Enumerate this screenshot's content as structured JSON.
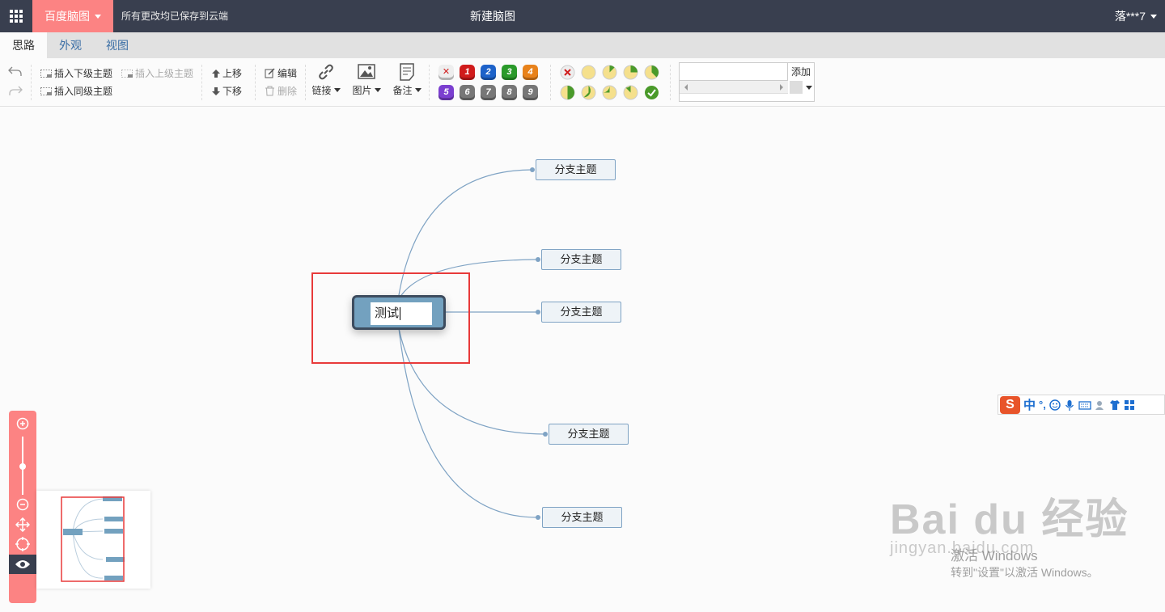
{
  "topbar": {
    "brand": "百度脑图",
    "save_status": "所有更改均已保存到云端",
    "doc_title": "新建脑图",
    "user": "落***7"
  },
  "tabs": [
    {
      "label": "思路",
      "active": true
    },
    {
      "label": "外观",
      "active": false
    },
    {
      "label": "视图",
      "active": false
    }
  ],
  "toolbar": {
    "insert_child": "插入下级主题",
    "insert_parent": "插入上级主题",
    "insert_sibling": "插入同级主题",
    "move_up": "上移",
    "move_down": "下移",
    "edit": "编辑",
    "delete": "删除",
    "link": "链接",
    "image": "图片",
    "note": "备注",
    "priorities": [
      "1",
      "2",
      "3",
      "4",
      "5",
      "6",
      "7",
      "8",
      "9"
    ],
    "resource_input_value": "",
    "resource_add": "添加"
  },
  "mindmap": {
    "root": "测试",
    "branches": [
      "分支主题",
      "分支主题",
      "分支主题",
      "分支主题",
      "分支主题"
    ]
  },
  "ime": {
    "logo": "S",
    "mode": "中",
    "punct": "°,"
  },
  "watermark": {
    "logo": "Bai du 经验",
    "url": "jingyan.baidu.com",
    "activate": "激活 Windows",
    "activate_sub": "转到\"设置\"以激活 Windows。"
  },
  "colors": {
    "topbar": "#393f4f",
    "brand": "#fc8383",
    "root_fill": "#73a1bf",
    "root_border": "#3d4c5e",
    "branch_fill": "#eef3f7",
    "link_line": "#7fa3c4",
    "highlight": "#e83a3a",
    "priority": [
      "#d01b1b",
      "#1d62c9",
      "#2a9a2a",
      "#e8821b",
      "#7b3fd0",
      "#777777",
      "#777777",
      "#777777",
      "#777777"
    ]
  }
}
